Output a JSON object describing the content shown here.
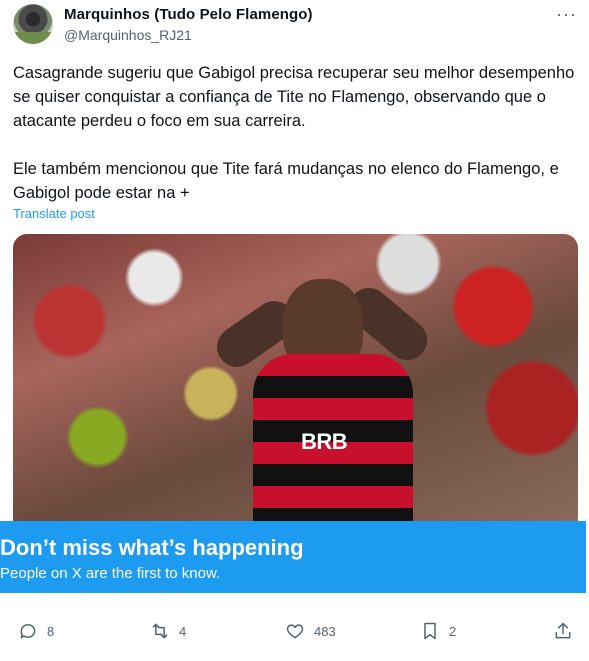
{
  "author": {
    "display_name": "Marquinhos (Tudo Pelo Flamengo)",
    "handle": "@Marquinhos_RJ21"
  },
  "menu": {
    "more_icon": "ellipsis-icon"
  },
  "post": {
    "paragraphs": [
      "Casagrande sugeriu que Gabigol precisa recuperar seu melhor desempenho se quiser conquistar a confiança de Tite no Flamengo, observando que o atacante perdeu o foco em sua carreira.",
      "Ele também mencionou que Tite fará mudanças no elenco do Flamengo, e Gabigol pode estar na +"
    ],
    "translate_label": "Translate post",
    "media_sponsor_text": "BRB"
  },
  "banner": {
    "title": "Don’t miss what’s happening",
    "subtitle": "People on X are the first to know.",
    "color": "#1d9bf0"
  },
  "actions": {
    "replies": "8",
    "reposts": "4",
    "likes": "483",
    "bookmarks": "2"
  },
  "colors": {
    "text": "#0f1419",
    "secondary": "#536471",
    "link": "#1d9bf0"
  }
}
